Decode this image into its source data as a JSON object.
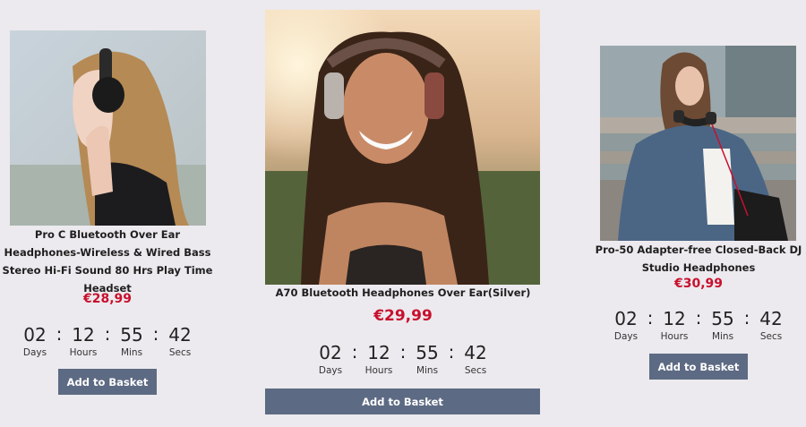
{
  "products": [
    {
      "image": "woman-side-profile-headphones-photo",
      "title_lines": [
        "Pro C Bluetooth Over Ear",
        "Headphones-Wireless & Wired Bass",
        "Stereo Hi-Fi Sound 80 Hrs Play Time",
        "Headset"
      ],
      "price": "€28,99",
      "countdown": {
        "days": "02",
        "hours": "12",
        "mins": "55",
        "secs": "42"
      },
      "button_label": "Add to Basket"
    },
    {
      "image": "smiling-woman-headphones-sunset-photo",
      "title_lines": [
        "A70 Bluetooth Headphones Over Ear(Silver)"
      ],
      "price": "€29,99",
      "countdown": {
        "days": "02",
        "hours": "12",
        "mins": "55",
        "secs": "42"
      },
      "button_label": "Add to Basket"
    },
    {
      "image": "woman-denim-jacket-headphones-photo",
      "title_lines": [
        "Pro-50 Adapter-free Closed-Back DJ",
        "Studio Headphones"
      ],
      "price": "€30,99",
      "countdown": {
        "days": "02",
        "hours": "12",
        "mins": "55",
        "secs": "42"
      },
      "button_label": "Add to Basket"
    }
  ],
  "countdown_labels": {
    "days": "Days",
    "hours": "Hours",
    "mins": "Mins",
    "secs": "Secs"
  },
  "separator": ":"
}
